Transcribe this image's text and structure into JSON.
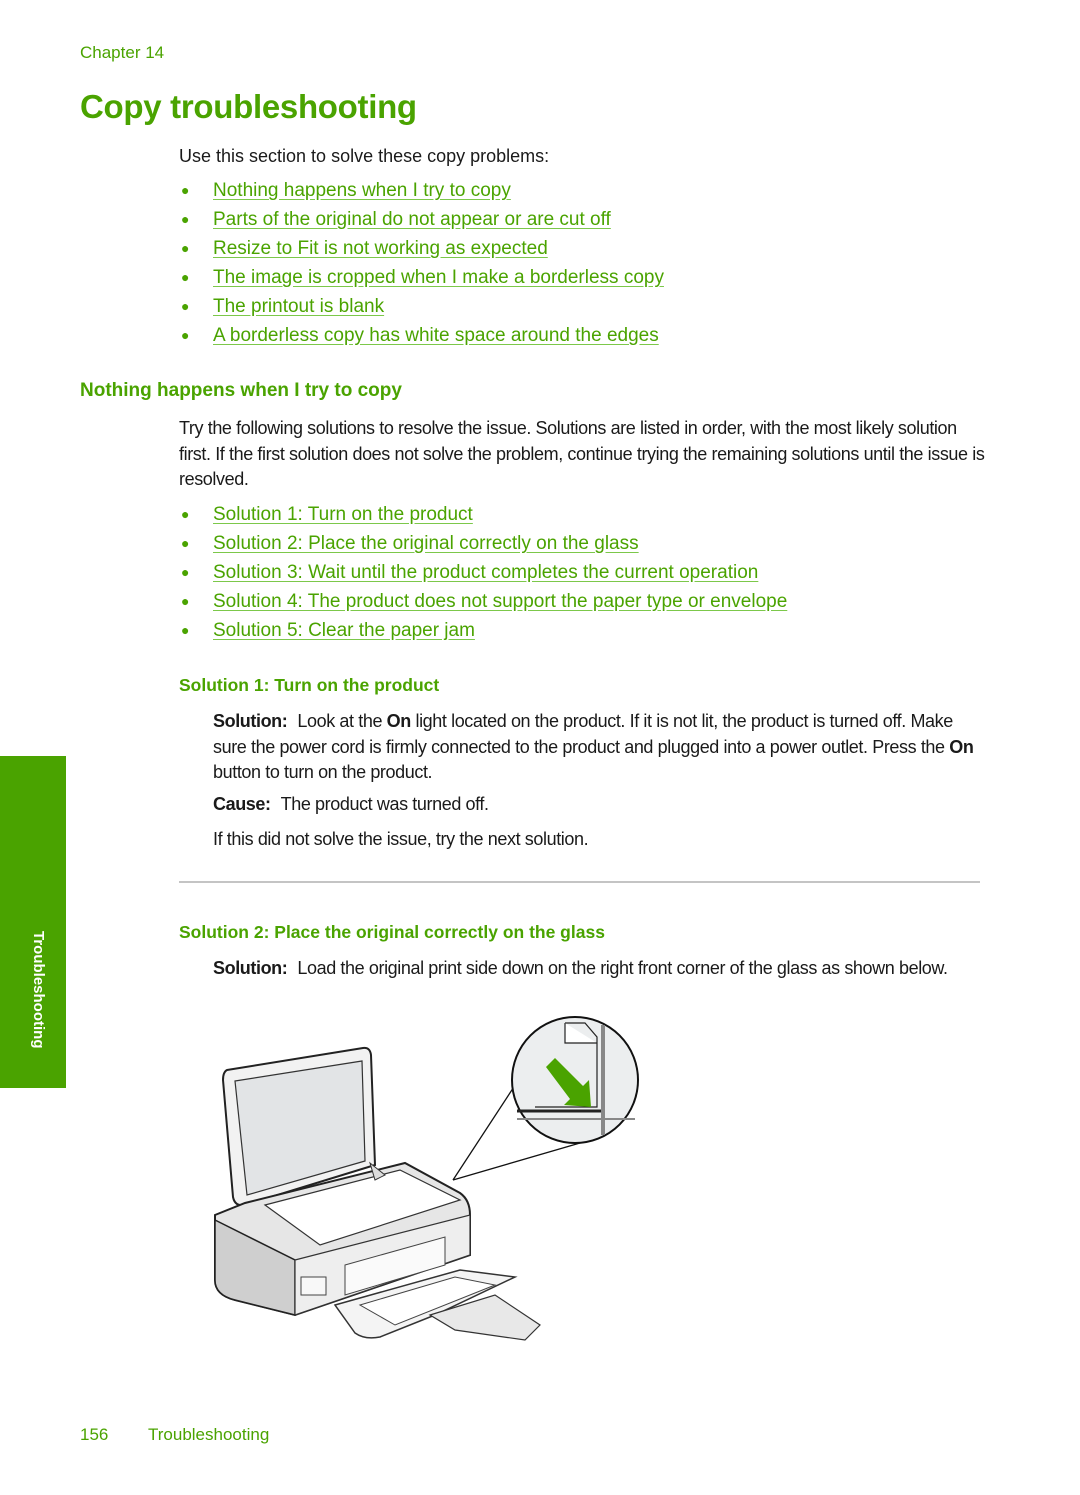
{
  "header": {
    "chapter": "Chapter 14"
  },
  "page_title": "Copy troubleshooting",
  "intro": "Use this section to solve these copy problems:",
  "topic_links": [
    "Nothing happens when I try to copy",
    "Parts of the original do not appear or are cut off",
    "Resize to Fit is not working as expected",
    "The image is cropped when I make a borderless copy",
    "The printout is blank",
    "A borderless copy has white space around the edges"
  ],
  "section": {
    "heading": "Nothing happens when I try to copy",
    "intro": "Try the following solutions to resolve the issue. Solutions are listed in order, with the most likely solution first. If the first solution does not solve the problem, continue trying the remaining solutions until the issue is resolved.",
    "solution_links": [
      "Solution 1: Turn on the product",
      "Solution 2: Place the original correctly on the glass",
      "Solution 3: Wait until the product completes the current operation",
      "Solution 4: The product does not support the paper type or envelope",
      "Solution 5: Clear the paper jam"
    ]
  },
  "solution1": {
    "heading": "Solution 1: Turn on the product",
    "solution_label": "Solution:",
    "solution_text_1": "Look at the ",
    "on_1": "On",
    "solution_text_2": " light located on the product. If it is not lit, the product is turned off. Make sure the power cord is firmly connected to the product and plugged into a power outlet. Press the ",
    "on_2": "On",
    "solution_text_3": " button to turn on the product.",
    "cause_label": "Cause:",
    "cause_text": "The product was turned off.",
    "next": "If this did not solve the issue, try the next solution."
  },
  "solution2": {
    "heading": "Solution 2: Place the original correctly on the glass",
    "solution_label": "Solution:",
    "solution_text": "Load the original print side down on the right front corner of the glass as shown below."
  },
  "side_tab": {
    "label": "Troubleshooting"
  },
  "footer": {
    "page_number": "156",
    "section": "Troubleshooting"
  },
  "colors": {
    "accent": "#4aa300",
    "text": "#1a1a1a",
    "divider": "#c4c4c4"
  }
}
